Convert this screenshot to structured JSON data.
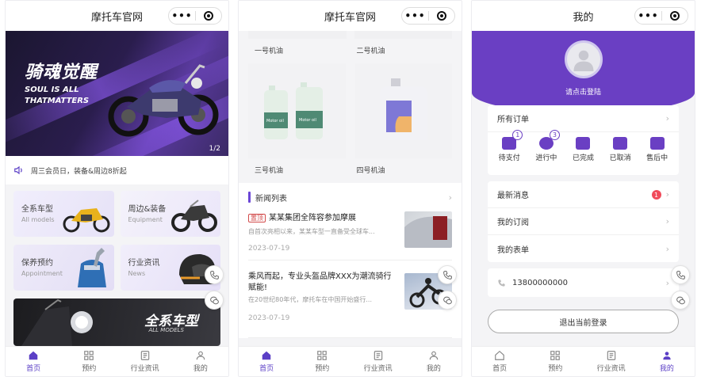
{
  "pages": {
    "home": {
      "title": "摩托车官网",
      "banner": {
        "cn": "骑魂觉醒",
        "en": "SOUL IS ALL\nTHATMATTERS",
        "pager": "1/2"
      },
      "notice": "周三会员日，装备&周边8折起",
      "categories": [
        {
          "title": "全系车型",
          "sub": "All models"
        },
        {
          "title": "周边&装备",
          "sub": "Equipment"
        },
        {
          "title": "保养预约",
          "sub": "Appointment"
        },
        {
          "title": "行业资讯",
          "sub": "News"
        }
      ],
      "promo": {
        "title": "全系车型",
        "sub": "ALL MODELS"
      }
    },
    "products": {
      "title": "摩托车官网",
      "labels_top": [
        "一号机油",
        "二号机油"
      ],
      "labels_bottom": [
        "三号机油",
        "四号机油"
      ],
      "bottle_label": "Motor oil",
      "news_title": "新闻列表",
      "news": [
        {
          "tag": "置顶",
          "title": "某某集团全阵容参加摩展",
          "excerpt": "自首次亮相以来，某某车型一直备受全球车...",
          "date": "2023-07-19"
        },
        {
          "title": "乘风而起，专业头盔品牌XXX为潮流骑行赋能!",
          "excerpt": "在20世纪80年代，摩托车在中国开始盛行...",
          "date": "2023-07-19"
        }
      ]
    },
    "mine": {
      "title": "我的",
      "login": "请点击登陆",
      "all_orders": "所有订单",
      "order_states": [
        {
          "label": "待支付",
          "badge": "1"
        },
        {
          "label": "进行中",
          "badge": "3"
        },
        {
          "label": "已完成"
        },
        {
          "label": "已取消"
        },
        {
          "label": "售后中"
        }
      ],
      "rows": [
        {
          "label": "最新消息",
          "badge": "1"
        },
        {
          "label": "我的订阅"
        },
        {
          "label": "我的表单"
        }
      ],
      "phone": "13800000000",
      "logout": "退出当前登录"
    }
  },
  "tabbar": [
    "首页",
    "预约",
    "行业资讯",
    "我的"
  ],
  "colors": {
    "accent": "#6a3fc3",
    "tab_active": "#5b3fc6",
    "badge_red": "#f04a5a"
  }
}
